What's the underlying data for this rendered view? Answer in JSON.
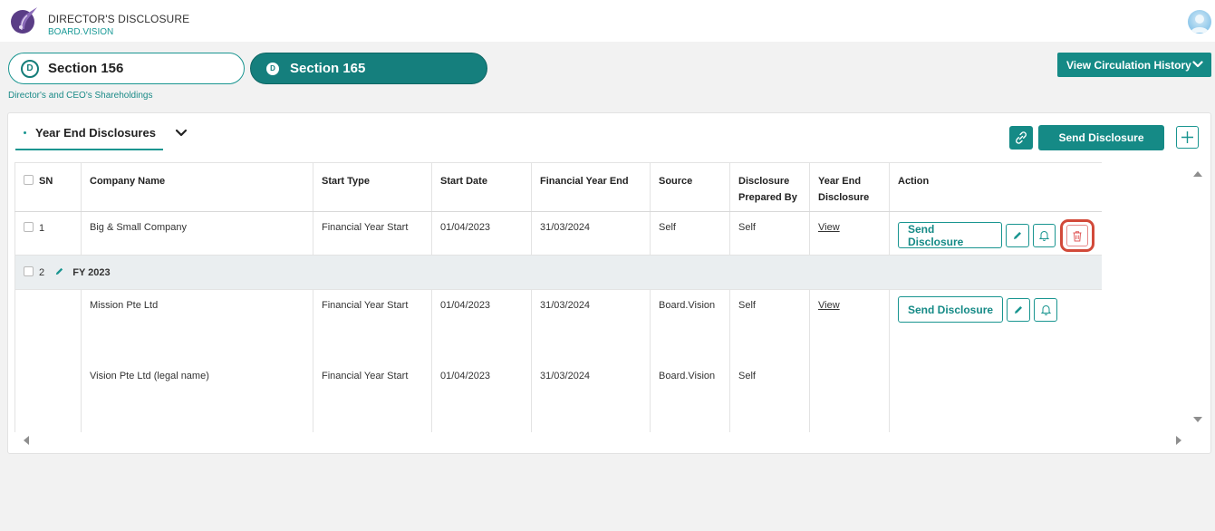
{
  "header": {
    "app_title": "DIRECTOR'S DISCLOSURE",
    "app_subtitle": "BOARD.VISION"
  },
  "sections": {
    "section156": {
      "badge": "D",
      "label": "Section 156"
    },
    "section165": {
      "badge": "D",
      "label": "Section 165"
    }
  },
  "circulation_history_label": "View Circulation History",
  "subtitle": "Director's and CEO's Shareholdings",
  "tab": {
    "label": "Year End Disclosures"
  },
  "toolbar": {
    "send_disclosure_label": "Send Disclosure"
  },
  "table": {
    "columns": [
      "SN",
      "Company Name",
      "Start Type",
      "Start Date",
      "Financial Year End",
      "Source",
      "Disclosure Prepared By",
      "Year End Disclosure",
      "Action"
    ],
    "rows": [
      {
        "sn": "1",
        "company": "Big & Small Company",
        "start_type": "Financial Year Start",
        "start_date": "01/04/2023",
        "fy_end": "31/03/2024",
        "source": "Self",
        "prepared_by": "Self",
        "year_end": "View",
        "action_label": "Send Disclosure"
      }
    ],
    "group": {
      "sn": "2",
      "label": "FY 2023",
      "rows": [
        {
          "company": "Mission Pte Ltd",
          "start_type": "Financial Year Start",
          "start_date": "01/04/2023",
          "fy_end": "31/03/2024",
          "source": "Board.Vision",
          "prepared_by": "Self",
          "year_end": "View",
          "action_label": "Send Disclosure"
        },
        {
          "company": "Vision Pte Ltd (legal name)",
          "start_type": "Financial Year Start",
          "start_date": "01/04/2023",
          "fy_end": "31/03/2024",
          "source": "Board.Vision",
          "prepared_by": "Self"
        }
      ]
    }
  },
  "colors": {
    "accent": "#158a86",
    "accent_dark": "#157f7d",
    "highlight": "#d24a3a",
    "group_bg": "#eaeef0"
  }
}
